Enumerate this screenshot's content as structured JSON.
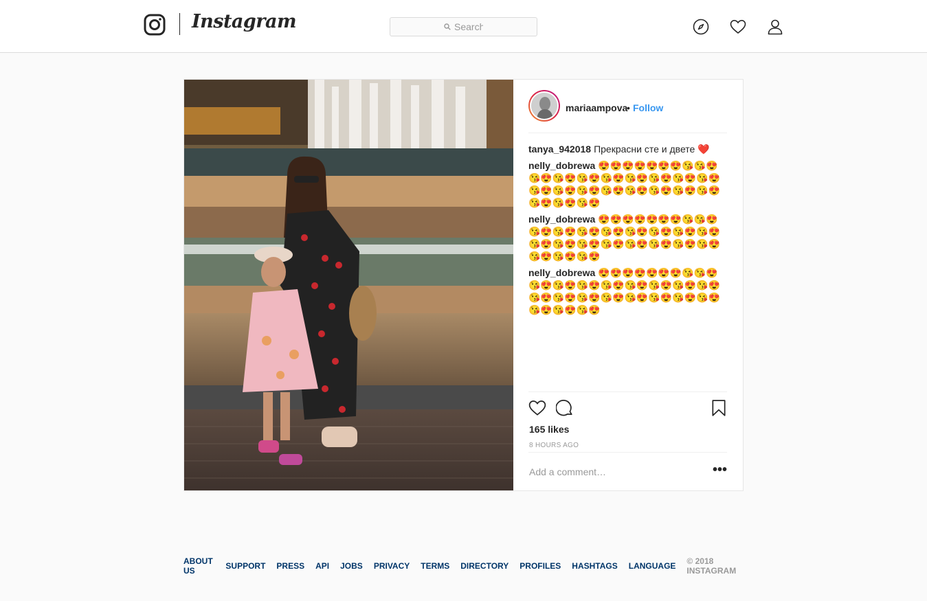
{
  "app": {
    "wordmark": "Instagram"
  },
  "search": {
    "placeholder": "Search"
  },
  "post": {
    "author": "mariaampova",
    "separator": "•",
    "follow_label": "Follow",
    "comments": [
      {
        "user": "tanya_942018",
        "text": "Прекрасни сте и двете ❤️"
      },
      {
        "user": "nelly_dobrewa",
        "text": "😍😍😍😍😍😍😍😘😘😍😘😍😘😍😘😍😘😍😘😍😘😍😘😍😘😍😘😍😘😍😘😍😘😍😘😍😘😍😘😍😘😍😘😍😘😍😘😍"
      },
      {
        "user": "nelly_dobrewa",
        "text": "😍😍😍😍😍😍😍😘😘😍😘😍😘😍😘😍😘😍😘😍😘😍😘😍😘😍😘😍😘😍😘😍😘😍😘😍😘😍😘😍😘😍😘😍😘😍😘😍"
      },
      {
        "user": "nelly_dobrewa",
        "text": "😍😍😍😍😍😍😍😘😘😍😘😍😘😍😘😍😘😍😘😍😘😍😘😍😘😍😘😍😘😍😘😍😘😍😘😍😘😍😘😍😘😍😘😍😘😍😘😍"
      }
    ],
    "likes": "165 likes",
    "time": "8 HOURS AGO",
    "comment_placeholder": "Add a comment…",
    "more_label": "•••"
  },
  "footer": {
    "links": [
      "ABOUT US",
      "SUPPORT",
      "PRESS",
      "API",
      "JOBS",
      "PRIVACY",
      "TERMS",
      "DIRECTORY",
      "PROFILES",
      "HASHTAGS",
      "LANGUAGE"
    ],
    "copyright": "© 2018 INSTAGRAM"
  },
  "colors": {
    "link_blue": "#3897f0",
    "footer_link": "#003569",
    "border": "#dbdbdb"
  }
}
